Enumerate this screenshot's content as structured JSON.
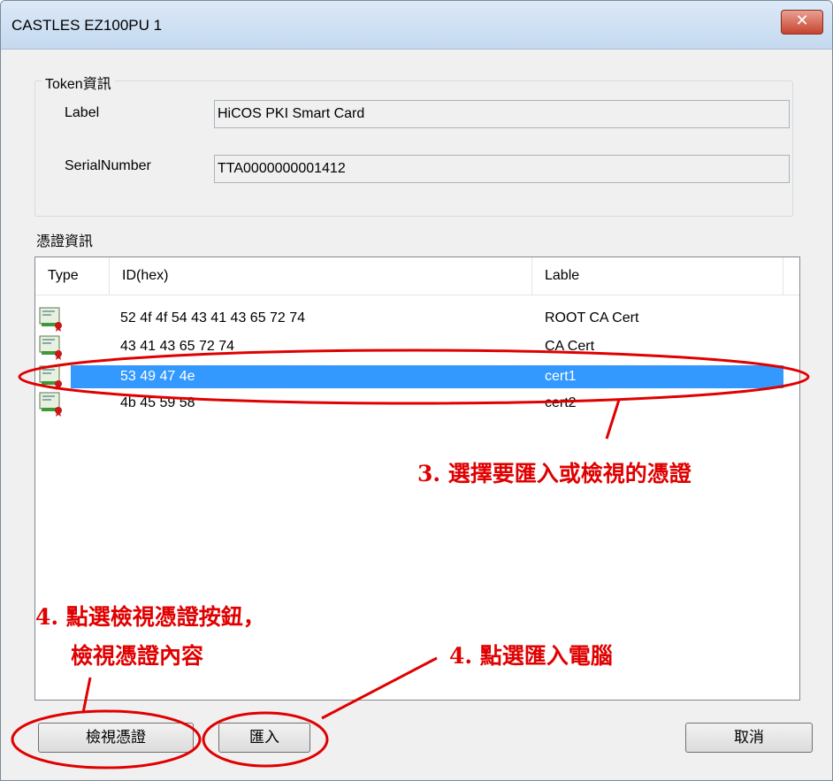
{
  "window": {
    "title": "CASTLES EZ100PU 1"
  },
  "token_group": {
    "title": "Token資訊",
    "label_caption": "Label",
    "label_value": "HiCOS PKI Smart Card",
    "serial_caption": "SerialNumber",
    "serial_value": "TTA0000000001412"
  },
  "cert_section": {
    "title": "憑證資訊"
  },
  "cert_table": {
    "columns": [
      "Type",
      "ID(hex)",
      "Lable"
    ],
    "rows": [
      {
        "id_hex": "52 4f 4f 54 43 41 43 65 72 74",
        "label": "ROOT CA Cert",
        "icon": "certificate-icon"
      },
      {
        "id_hex": "43 41 43 65 72 74",
        "label": "CA Cert",
        "icon": "certificate-icon"
      },
      {
        "id_hex": "53 49 47 4e",
        "label": "cert1",
        "icon": "certificate-icon",
        "selected": true
      },
      {
        "id_hex": "4b 45 59 58",
        "label": "cert2",
        "icon": "certificate-icon"
      }
    ]
  },
  "buttons": {
    "view": "檢視憑證",
    "import": "匯入",
    "cancel": "取消"
  },
  "annotations": {
    "step3": "3. 選擇要匯入或檢視的憑證",
    "step4_view_line1": "4. 點選檢視憑證按鈕，",
    "step4_view_line2": "檢視憑證內容",
    "step4_import": "4. 點選匯入電腦"
  },
  "colors": {
    "selection": "#3399ff",
    "annotation": "#e00000",
    "close_button": "#c7442f"
  }
}
